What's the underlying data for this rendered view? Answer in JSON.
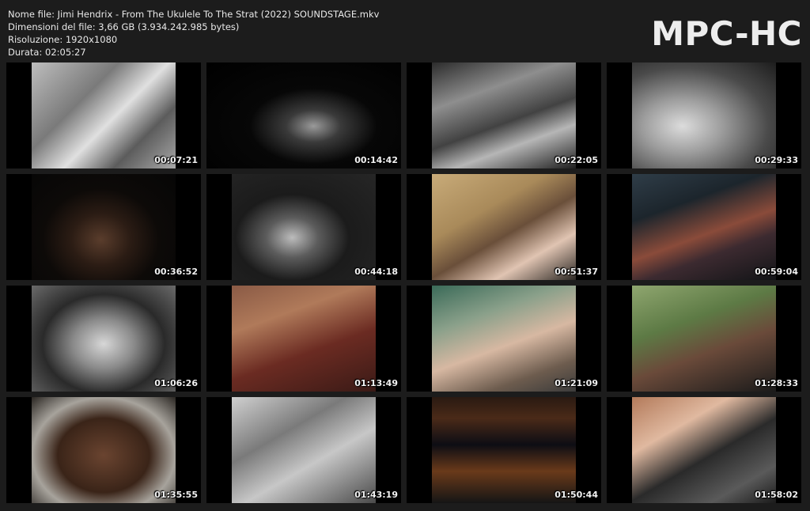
{
  "info": {
    "line1": "Nome file: Jimi Hendrix - From The Ukulele To The Strat (2022) SOUNDSTAGE.mkv",
    "line2": "Dimensioni del file: 3,66 GB (3.934.242.985 bytes)",
    "line3": "Risoluzione: 1920x1080",
    "line4": "Durata: 02:05:27"
  },
  "logo": "MPC-HC",
  "thumbnails": [
    {
      "time": "00:07:21"
    },
    {
      "time": "00:14:42"
    },
    {
      "time": "00:22:05"
    },
    {
      "time": "00:29:33"
    },
    {
      "time": "00:36:52"
    },
    {
      "time": "00:44:18"
    },
    {
      "time": "00:51:37"
    },
    {
      "time": "00:59:04"
    },
    {
      "time": "01:06:26"
    },
    {
      "time": "01:13:49"
    },
    {
      "time": "01:21:09"
    },
    {
      "time": "01:28:33"
    },
    {
      "time": "01:35:55"
    },
    {
      "time": "01:43:19"
    },
    {
      "time": "01:50:44"
    },
    {
      "time": "01:58:02"
    }
  ]
}
